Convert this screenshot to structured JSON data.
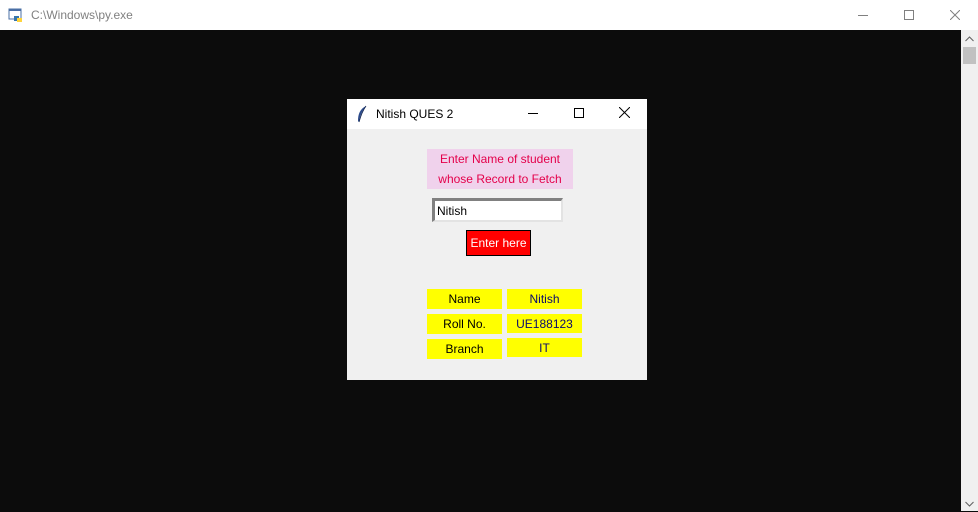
{
  "console": {
    "title": "C:\\Windows\\py.exe",
    "icon": "python-console-icon",
    "buttons": {
      "minimize": "minimize-icon",
      "maximize": "maximize-icon",
      "close": "close-icon"
    }
  },
  "tk_window": {
    "title": "Nitish QUES 2",
    "icon": "tk-feather-icon",
    "prompt_line1": "Enter Name of student",
    "prompt_line2": "whose Record to Fetch",
    "entry_value": "Nitish",
    "button_label": "Enter here",
    "record": {
      "rows": [
        {
          "label": "Name",
          "value": "Nitish"
        },
        {
          "label": "Roll No.",
          "value": "UE188123"
        },
        {
          "label": "Branch",
          "value": "IT"
        }
      ]
    }
  },
  "colors": {
    "prompt_bg": "#f0d2ec",
    "prompt_text": "#e4004a",
    "button_bg": "#ff0000",
    "cell_bg": "#ffff00",
    "console_bg": "#0c0c0c"
  }
}
